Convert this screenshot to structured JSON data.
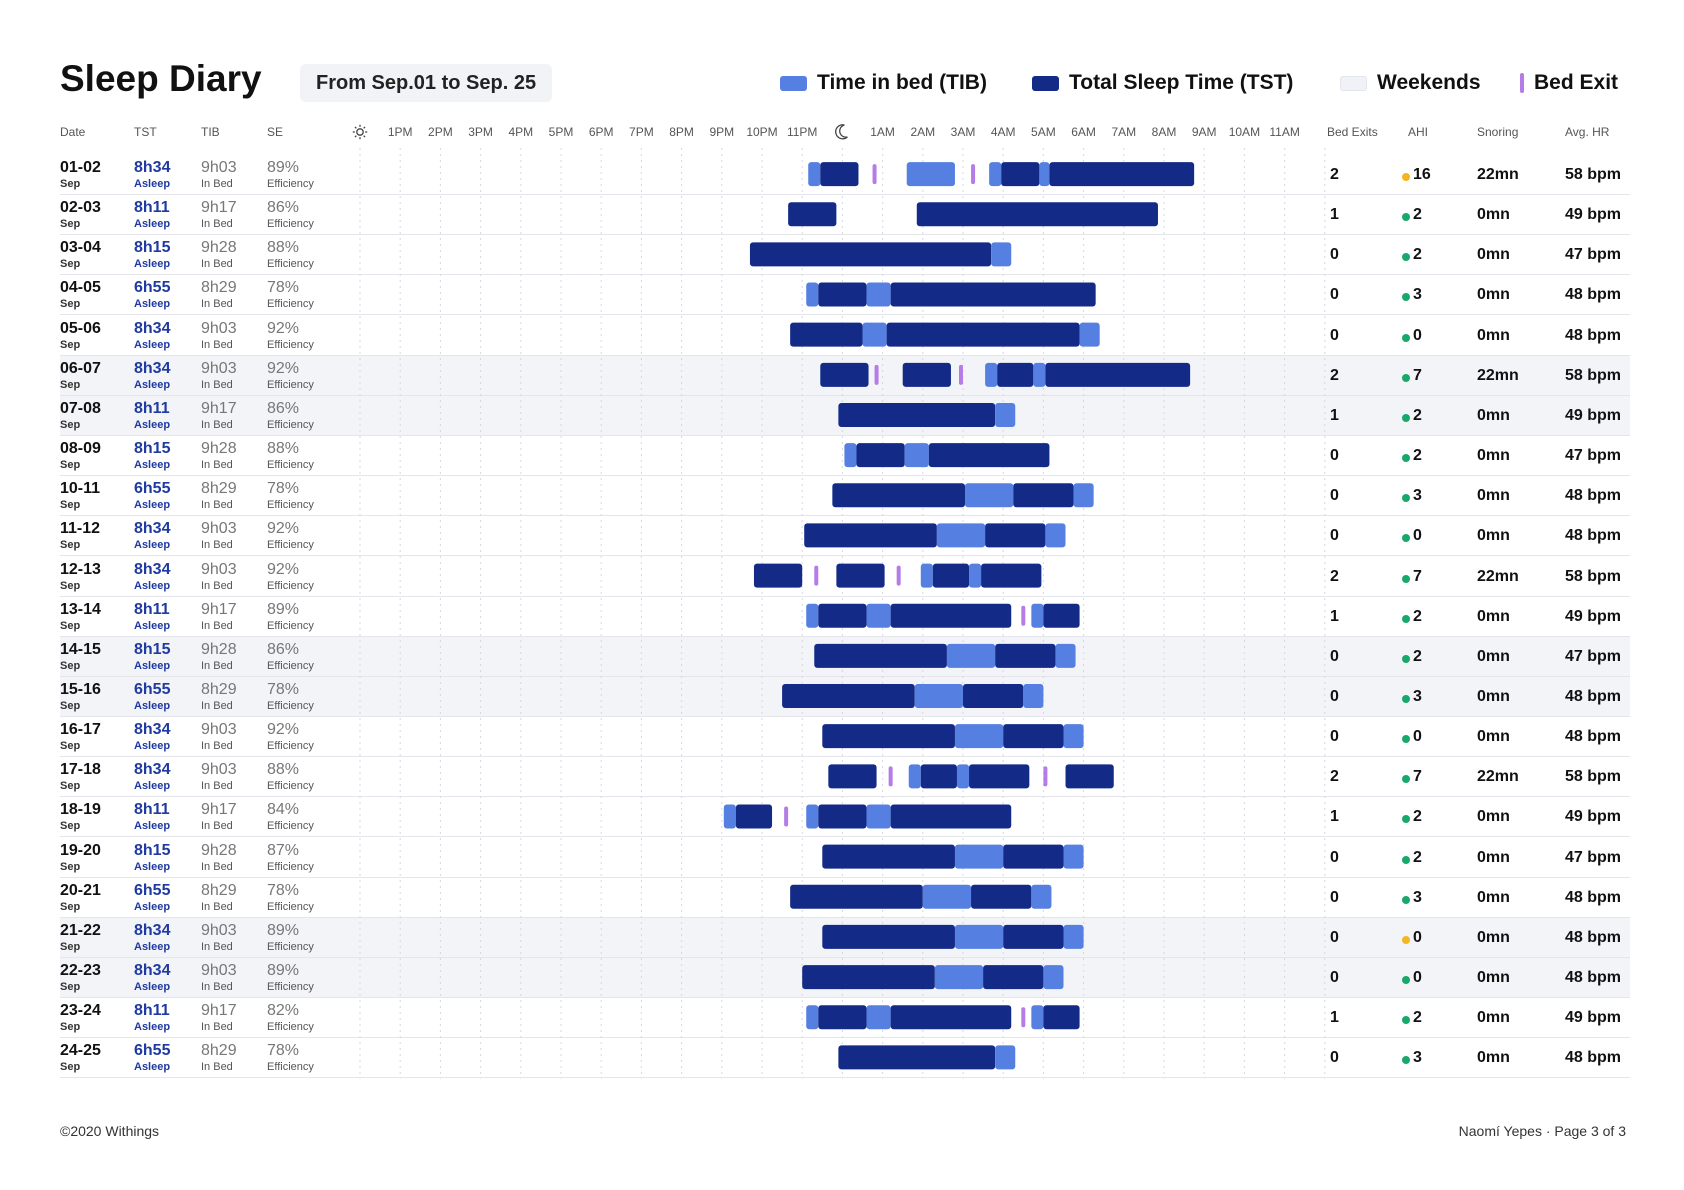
{
  "header": {
    "title": "Sleep Diary",
    "range": "From Sep.01 to Sep. 25"
  },
  "legend": {
    "tib": "Time in bed (TIB)",
    "tst": "Total Sleep Time (TST)",
    "weekends": "Weekends",
    "bed_exit": "Bed Exit"
  },
  "columns": {
    "date": "Date",
    "tst": "TST",
    "tib": "TIB",
    "se": "SE",
    "bed_exits": "Bed Exits",
    "ahi": "AHI",
    "snoring": "Snoring",
    "hr": "Avg. HR"
  },
  "labels": {
    "sep": "Sep",
    "asleep": "Asleep",
    "in_bed": "In Bed",
    "efficiency": "Efficiency"
  },
  "colors": {
    "tib": "#5580e1",
    "tst": "#132a87",
    "exit": "#b57ce8",
    "ahi_ok": "#1aa86a",
    "ahi_warn": "#f5b521",
    "weekend_bg": "#f3f4f8"
  },
  "hour_ticks": [
    "1PM",
    "2PM",
    "3PM",
    "4PM",
    "5PM",
    "6PM",
    "7PM",
    "8PM",
    "9PM",
    "10PM",
    "11PM",
    "1AM",
    "2AM",
    "3AM",
    "4AM",
    "5AM",
    "6AM",
    "7AM",
    "8AM",
    "9AM",
    "10AM",
    "11AM"
  ],
  "icons": {
    "day": "sun-icon",
    "midnight": "moon-icon"
  },
  "chart_data": {
    "type": "gantt",
    "x_axis": "time of day (hours from 12PM)",
    "xlim": [
      12,
      36
    ],
    "segment_kinds": [
      "tib",
      "tst"
    ],
    "rows": [
      {
        "date": "01-02",
        "tst": "8h34",
        "tib": "9h03",
        "se": "89%",
        "bed_exits": "2",
        "ahi": "16",
        "ahi_level": "warn",
        "snoring": "22mn",
        "hr": "58 bpm",
        "weekend": false,
        "segments": [
          [
            23.15,
            23.45,
            "tib"
          ],
          [
            23.45,
            24.4,
            "tst"
          ],
          [
            25.6,
            26.8,
            "tib"
          ],
          [
            27.65,
            27.95,
            "tib"
          ],
          [
            27.95,
            28.9,
            "tst"
          ],
          [
            28.9,
            29.15,
            "tib"
          ],
          [
            29.15,
            32.75,
            "tst"
          ]
        ],
        "exits": [
          24.8,
          27.25
        ]
      },
      {
        "date": "02-03",
        "tst": "8h11",
        "tib": "9h17",
        "se": "86%",
        "bed_exits": "1",
        "ahi": "2",
        "ahi_level": "ok",
        "snoring": "0mn",
        "hr": "49 bpm",
        "weekend": false,
        "segments": [
          [
            22.65,
            23.85,
            "tst"
          ],
          [
            25.85,
            31.85,
            "tst"
          ]
        ],
        "exits": []
      },
      {
        "date": "03-04",
        "tst": "8h15",
        "tib": "9h28",
        "se": "88%",
        "bed_exits": "0",
        "ahi": "2",
        "ahi_level": "ok",
        "snoring": "0mn",
        "hr": "47 bpm",
        "weekend": false,
        "segments": [
          [
            21.7,
            27.7,
            "tst"
          ],
          [
            27.7,
            28.2,
            "tib"
          ]
        ],
        "exits": []
      },
      {
        "date": "04-05",
        "tst": "6h55",
        "tib": "8h29",
        "se": "78%",
        "bed_exits": "0",
        "ahi": "3",
        "ahi_level": "ok",
        "snoring": "0mn",
        "hr": "48 bpm",
        "weekend": false,
        "segments": [
          [
            23.1,
            23.4,
            "tib"
          ],
          [
            23.4,
            24.6,
            "tst"
          ],
          [
            24.6,
            25.2,
            "tib"
          ],
          [
            25.2,
            30.3,
            "tst"
          ]
        ],
        "exits": []
      },
      {
        "date": "05-06",
        "tst": "8h34",
        "tib": "9h03",
        "se": "92%",
        "bed_exits": "0",
        "ahi": "0",
        "ahi_level": "ok",
        "snoring": "0mn",
        "hr": "48 bpm",
        "weekend": false,
        "segments": [
          [
            22.7,
            24.5,
            "tst"
          ],
          [
            24.5,
            25.1,
            "tib"
          ],
          [
            25.1,
            29.9,
            "tst"
          ],
          [
            29.9,
            30.4,
            "tib"
          ]
        ],
        "exits": []
      },
      {
        "date": "06-07",
        "tst": "8h34",
        "tib": "9h03",
        "se": "92%",
        "bed_exits": "2",
        "ahi": "7",
        "ahi_level": "ok",
        "snoring": "22mn",
        "hr": "58 bpm",
        "weekend": true,
        "segments": [
          [
            23.45,
            24.65,
            "tst"
          ],
          [
            25.5,
            26.7,
            "tst"
          ],
          [
            27.55,
            27.85,
            "tib"
          ],
          [
            27.85,
            28.75,
            "tst"
          ],
          [
            28.75,
            29.05,
            "tib"
          ],
          [
            29.05,
            32.65,
            "tst"
          ]
        ],
        "exits": [
          24.85,
          26.95
        ]
      },
      {
        "date": "07-08",
        "tst": "8h11",
        "tib": "9h17",
        "se": "86%",
        "bed_exits": "1",
        "ahi": "2",
        "ahi_level": "ok",
        "snoring": "0mn",
        "hr": "49 bpm",
        "weekend": true,
        "segments": [
          [
            23.9,
            27.8,
            "tst"
          ],
          [
            27.8,
            28.3,
            "tib"
          ]
        ],
        "exits": []
      },
      {
        "date": "08-09",
        "tst": "8h15",
        "tib": "9h28",
        "se": "88%",
        "bed_exits": "0",
        "ahi": "2",
        "ahi_level": "ok",
        "snoring": "0mn",
        "hr": "47 bpm",
        "weekend": false,
        "segments": [
          [
            24.05,
            24.35,
            "tib"
          ],
          [
            24.35,
            25.55,
            "tst"
          ],
          [
            25.55,
            26.15,
            "tib"
          ],
          [
            26.15,
            29.15,
            "tst"
          ]
        ],
        "exits": []
      },
      {
        "date": "10-11",
        "tst": "6h55",
        "tib": "8h29",
        "se": "78%",
        "bed_exits": "0",
        "ahi": "3",
        "ahi_level": "ok",
        "snoring": "0mn",
        "hr": "48 bpm",
        "weekend": false,
        "segments": [
          [
            23.75,
            27.05,
            "tst"
          ],
          [
            27.05,
            28.25,
            "tib"
          ],
          [
            28.25,
            29.75,
            "tst"
          ],
          [
            29.75,
            30.25,
            "tib"
          ]
        ],
        "exits": []
      },
      {
        "date": "11-12",
        "tst": "8h34",
        "tib": "9h03",
        "se": "92%",
        "bed_exits": "0",
        "ahi": "0",
        "ahi_level": "ok",
        "snoring": "0mn",
        "hr": "48 bpm",
        "weekend": false,
        "segments": [
          [
            23.05,
            26.35,
            "tst"
          ],
          [
            26.35,
            27.55,
            "tib"
          ],
          [
            27.55,
            29.05,
            "tst"
          ],
          [
            29.05,
            29.55,
            "tib"
          ]
        ],
        "exits": []
      },
      {
        "date": "12-13",
        "tst": "8h34",
        "tib": "9h03",
        "se": "92%",
        "bed_exits": "2",
        "ahi": "7",
        "ahi_level": "ok",
        "snoring": "22mn",
        "hr": "58 bpm",
        "weekend": false,
        "segments": [
          [
            21.8,
            23.0,
            "tst"
          ],
          [
            23.85,
            25.05,
            "tst"
          ],
          [
            25.95,
            26.25,
            "tib"
          ],
          [
            26.25,
            27.15,
            "tst"
          ],
          [
            27.15,
            27.45,
            "tib"
          ],
          [
            27.45,
            28.95,
            "tst"
          ]
        ],
        "exits": [
          23.35,
          25.4
        ]
      },
      {
        "date": "13-14",
        "tst": "8h11",
        "tib": "9h17",
        "se": "89%",
        "bed_exits": "1",
        "ahi": "2",
        "ahi_level": "ok",
        "snoring": "0mn",
        "hr": "49 bpm",
        "weekend": false,
        "segments": [
          [
            23.1,
            23.4,
            "tib"
          ],
          [
            23.4,
            24.6,
            "tst"
          ],
          [
            24.6,
            25.2,
            "tib"
          ],
          [
            25.2,
            28.2,
            "tst"
          ],
          [
            28.7,
            29.0,
            "tib"
          ],
          [
            29.0,
            29.9,
            "tst"
          ]
        ],
        "exits": [
          28.5
        ]
      },
      {
        "date": "14-15",
        "tst": "8h15",
        "tib": "9h28",
        "se": "86%",
        "bed_exits": "0",
        "ahi": "2",
        "ahi_level": "ok",
        "snoring": "0mn",
        "hr": "47 bpm",
        "weekend": true,
        "segments": [
          [
            23.3,
            26.6,
            "tst"
          ],
          [
            26.6,
            27.8,
            "tib"
          ],
          [
            27.8,
            29.3,
            "tst"
          ],
          [
            29.3,
            29.8,
            "tib"
          ]
        ],
        "exits": []
      },
      {
        "date": "15-16",
        "tst": "6h55",
        "tib": "8h29",
        "se": "78%",
        "bed_exits": "0",
        "ahi": "3",
        "ahi_level": "ok",
        "snoring": "0mn",
        "hr": "48 bpm",
        "weekend": true,
        "segments": [
          [
            22.5,
            25.8,
            "tst"
          ],
          [
            25.8,
            27.0,
            "tib"
          ],
          [
            27.0,
            28.5,
            "tst"
          ],
          [
            28.5,
            29.0,
            "tib"
          ]
        ],
        "exits": []
      },
      {
        "date": "16-17",
        "tst": "8h34",
        "tib": "9h03",
        "se": "92%",
        "bed_exits": "0",
        "ahi": "0",
        "ahi_level": "ok",
        "snoring": "0mn",
        "hr": "48 bpm",
        "weekend": false,
        "segments": [
          [
            23.5,
            26.8,
            "tst"
          ],
          [
            26.8,
            28.0,
            "tib"
          ],
          [
            28.0,
            29.5,
            "tst"
          ],
          [
            29.5,
            30.0,
            "tib"
          ]
        ],
        "exits": []
      },
      {
        "date": "17-18",
        "tst": "8h34",
        "tib": "9h03",
        "se": "88%",
        "bed_exits": "2",
        "ahi": "7",
        "ahi_level": "ok",
        "snoring": "22mn",
        "hr": "58 bpm",
        "weekend": false,
        "segments": [
          [
            23.65,
            24.85,
            "tst"
          ],
          [
            25.65,
            25.95,
            "tib"
          ],
          [
            25.95,
            26.85,
            "tst"
          ],
          [
            26.85,
            27.15,
            "tib"
          ],
          [
            27.15,
            28.65,
            "tst"
          ],
          [
            29.55,
            30.75,
            "tst"
          ]
        ],
        "exits": [
          25.2,
          29.05
        ]
      },
      {
        "date": "18-19",
        "tst": "8h11",
        "tib": "9h17",
        "se": "84%",
        "bed_exits": "1",
        "ahi": "2",
        "ahi_level": "ok",
        "snoring": "0mn",
        "hr": "49 bpm",
        "weekend": false,
        "segments": [
          [
            21.05,
            21.35,
            "tib"
          ],
          [
            21.35,
            22.25,
            "tst"
          ],
          [
            23.1,
            23.4,
            "tib"
          ],
          [
            23.4,
            24.6,
            "tst"
          ],
          [
            24.6,
            25.2,
            "tib"
          ],
          [
            25.2,
            28.2,
            "tst"
          ]
        ],
        "exits": [
          22.6
        ]
      },
      {
        "date": "19-20",
        "tst": "8h15",
        "tib": "9h28",
        "se": "87%",
        "bed_exits": "0",
        "ahi": "2",
        "ahi_level": "ok",
        "snoring": "0mn",
        "hr": "47 bpm",
        "weekend": false,
        "segments": [
          [
            23.5,
            26.8,
            "tst"
          ],
          [
            26.8,
            28.0,
            "tib"
          ],
          [
            28.0,
            29.5,
            "tst"
          ],
          [
            29.5,
            30.0,
            "tib"
          ]
        ],
        "exits": []
      },
      {
        "date": "20-21",
        "tst": "6h55",
        "tib": "8h29",
        "se": "78%",
        "bed_exits": "0",
        "ahi": "3",
        "ahi_level": "ok",
        "snoring": "0mn",
        "hr": "48 bpm",
        "weekend": false,
        "segments": [
          [
            22.7,
            26.0,
            "tst"
          ],
          [
            26.0,
            27.2,
            "tib"
          ],
          [
            27.2,
            28.7,
            "tst"
          ],
          [
            28.7,
            29.2,
            "tib"
          ]
        ],
        "exits": []
      },
      {
        "date": "21-22",
        "tst": "8h34",
        "tib": "9h03",
        "se": "89%",
        "bed_exits": "0",
        "ahi": "0",
        "ahi_level": "warn",
        "snoring": "0mn",
        "hr": "48 bpm",
        "weekend": true,
        "segments": [
          [
            23.5,
            26.8,
            "tst"
          ],
          [
            26.8,
            28.0,
            "tib"
          ],
          [
            28.0,
            29.5,
            "tst"
          ],
          [
            29.5,
            30.0,
            "tib"
          ]
        ],
        "exits": []
      },
      {
        "date": "22-23",
        "tst": "8h34",
        "tib": "9h03",
        "se": "89%",
        "bed_exits": "0",
        "ahi": "0",
        "ahi_level": "ok",
        "snoring": "0mn",
        "hr": "48 bpm",
        "weekend": true,
        "segments": [
          [
            23.0,
            26.3,
            "tst"
          ],
          [
            26.3,
            27.5,
            "tib"
          ],
          [
            27.5,
            29.0,
            "tst"
          ],
          [
            29.0,
            29.5,
            "tib"
          ]
        ],
        "exits": []
      },
      {
        "date": "23-24",
        "tst": "8h11",
        "tib": "9h17",
        "se": "82%",
        "bed_exits": "1",
        "ahi": "2",
        "ahi_level": "ok",
        "snoring": "0mn",
        "hr": "49 bpm",
        "weekend": false,
        "segments": [
          [
            23.1,
            23.4,
            "tib"
          ],
          [
            23.4,
            24.6,
            "tst"
          ],
          [
            24.6,
            25.2,
            "tib"
          ],
          [
            25.2,
            28.2,
            "tst"
          ],
          [
            28.7,
            29.0,
            "tib"
          ],
          [
            29.0,
            29.9,
            "tst"
          ]
        ],
        "exits": [
          28.5
        ]
      },
      {
        "date": "24-25",
        "tst": "6h55",
        "tib": "8h29",
        "se": "78%",
        "bed_exits": "0",
        "ahi": "3",
        "ahi_level": "ok",
        "snoring": "0mn",
        "hr": "48 bpm",
        "weekend": false,
        "segments": [
          [
            23.9,
            27.8,
            "tst"
          ],
          [
            27.8,
            28.3,
            "tib"
          ]
        ],
        "exits": []
      }
    ]
  },
  "footer": {
    "left": "©2020 Withings",
    "right": "Naomí Yepes · Page 3 of 3"
  }
}
